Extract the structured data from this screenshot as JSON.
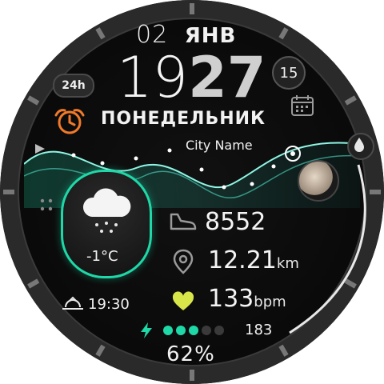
{
  "date": {
    "day": "02",
    "month": "ЯНВ"
  },
  "time": {
    "hours": "19",
    "minutes": "27",
    "seconds": "15",
    "format": "24h"
  },
  "weekday": "ПОНЕДЕЛЬНИК",
  "city": "City Name",
  "weather": {
    "temperature": "-1°C",
    "condition_icon": "snow-cloud-icon"
  },
  "stats": {
    "steps": {
      "value": "8552",
      "icon": "shoe-icon"
    },
    "distance": {
      "value": "12.21",
      "unit": "km",
      "icon": "location-pin-icon"
    },
    "heart": {
      "value": "133",
      "unit": "bpm",
      "icon": "heart-icon"
    }
  },
  "sunrise": {
    "time": "19:30",
    "icon": "sunrise-icon"
  },
  "battery": {
    "percent": "62%",
    "level": 0.62,
    "dots_filled": 3,
    "dots_total": 5
  },
  "secondary_value": "183",
  "colors": {
    "accent": "#1fd8a7",
    "heart": "#d8e64a",
    "alarm": "#f07a2a",
    "background": "#0b0b0b"
  }
}
